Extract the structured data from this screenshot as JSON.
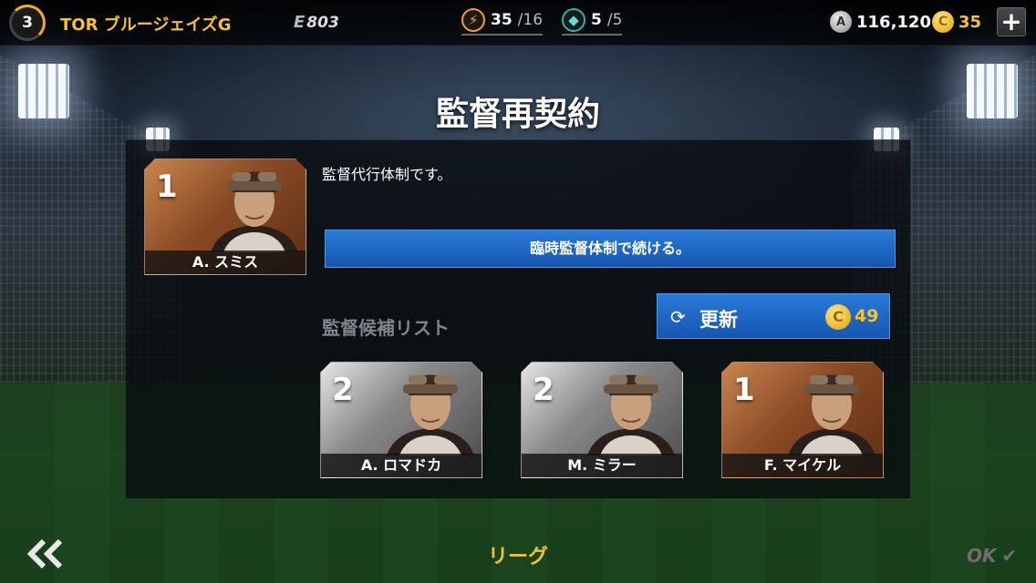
{
  "header": {
    "level": "3",
    "team_name": "TOR ブルージェイズG",
    "energy_label": "E",
    "energy_value": "803",
    "stamina": {
      "current": "35",
      "max": "/16",
      "icon": "bolt-icon"
    },
    "gems": {
      "current": "5",
      "max": "/5",
      "icon": "gem-icon"
    },
    "a_points": {
      "symbol": "A",
      "value": "116,120"
    },
    "coins": {
      "symbol": "C",
      "value": "35"
    },
    "add_label": "+"
  },
  "title": "監督再契約",
  "current_manager": {
    "rank": "1",
    "name": "A. スミス",
    "tier": "bronze"
  },
  "status_text": "監督代行体制です。",
  "continue_button_label": "臨時監督体制で続ける。",
  "candidate_list_label": "監督候補リスト",
  "refresh_button": {
    "label": "更新",
    "icon": "refresh-icon",
    "coin_symbol": "C",
    "cost": "49"
  },
  "candidates": [
    {
      "rank": "2",
      "name": "A. ロマドカ",
      "tier": "silver"
    },
    {
      "rank": "2",
      "name": "M. ミラー",
      "tier": "silver"
    },
    {
      "rank": "1",
      "name": "F. マイケル",
      "tier": "bronze"
    }
  ],
  "footer": {
    "back_icon": "double-chevron-left-icon",
    "label": "リーグ",
    "ok_label": "OK",
    "ok_icon": "check-icon"
  },
  "colors": {
    "accent_gold": "#f4c232",
    "button_blue": "#1e68c4",
    "bronze_card": "#a8622f",
    "silver_card": "#9a9a9a"
  }
}
